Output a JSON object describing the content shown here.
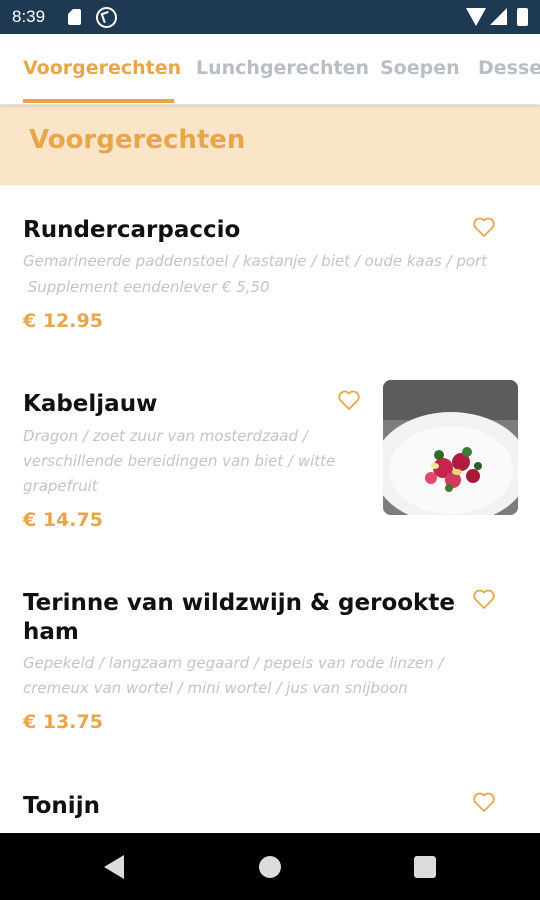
{
  "status_bar": {
    "time": "8:39"
  },
  "tabs": [
    {
      "label": "Voorgerechten",
      "active": true
    },
    {
      "label": "Lunchgerechten",
      "active": false
    },
    {
      "label": "Soepen",
      "active": false
    },
    {
      "label": "Desserts",
      "active": false
    }
  ],
  "section": {
    "title": "Voorgerechten"
  },
  "items": [
    {
      "name": "Rundercarpaccio",
      "desc_lines": [
        "Gemarineerde paddenstoel / kastanje / biet / oude kaas / port",
        " Supplement eendenlever € 5,50"
      ],
      "price": "€ 12.95",
      "favorite": false,
      "has_image": false
    },
    {
      "name": "Kabeljauw",
      "desc_lines": [
        "Dragon / zoet zuur van mosterdzaad /",
        "verschillende bereidingen van biet / witte",
        "grapefruit"
      ],
      "price": "€ 14.75",
      "favorite": false,
      "has_image": true
    },
    {
      "name_lines": [
        "Terinne van wildzwijn & gerookte",
        "ham"
      ],
      "desc_lines": [
        "Gepekeld / langzaam gegaard / pepeis van rode linzen /",
        "cremeux van wortel / mini wortel / jus van snijboon"
      ],
      "price": "€ 13.75",
      "favorite": false,
      "has_image": false
    },
    {
      "name": "Tonijn",
      "favorite": false,
      "has_image": false
    }
  ],
  "colors": {
    "accent": "#e8a64a",
    "section_bg": "#fbe5c8",
    "statusbar": "#1e3a52"
  },
  "icons": {
    "favorite": "heart-outline-icon"
  }
}
